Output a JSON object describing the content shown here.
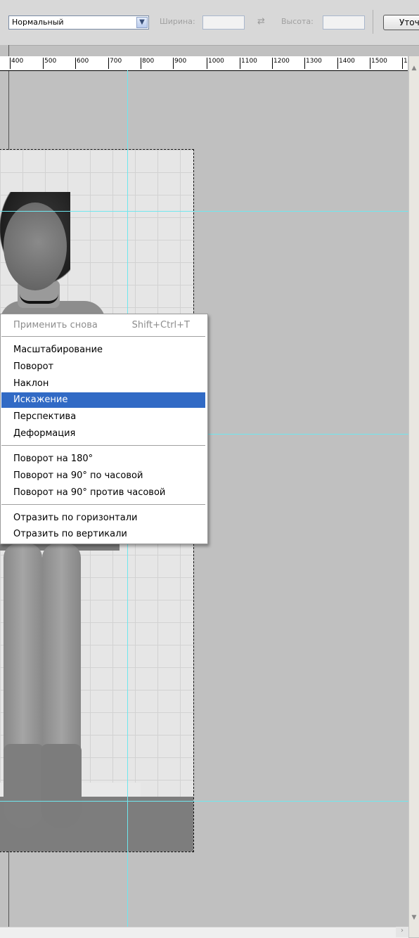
{
  "options_bar": {
    "mode_value": "Нормальный",
    "width_label": "Ширина:",
    "height_label": "Высота:",
    "refine_button": "Уточ"
  },
  "ruler": {
    "ticks": [
      "400",
      "500",
      "600",
      "700",
      "800",
      "900",
      "1000",
      "1100",
      "1200",
      "1300",
      "1400",
      "1500",
      "1"
    ]
  },
  "context_menu": {
    "repeat": {
      "label": "Применить снова",
      "shortcut": "Shift+Ctrl+T",
      "enabled": false
    },
    "transform_items": [
      "Масштабирование",
      "Поворот",
      "Наклон",
      "Искажение",
      "Перспектива",
      "Деформация"
    ],
    "selected_item": "Искажение",
    "rotate_items": [
      "Поворот на 180°",
      "Поворот на 90° по часовой",
      "Поворот на 90° против часовой"
    ],
    "flip_items": [
      "Отразить по горизонтали",
      "Отразить по вертикали"
    ]
  },
  "colors": {
    "guide": "#6fe7ef",
    "menu_highlight": "#316ac5",
    "workspace": "#c0c0c0"
  }
}
